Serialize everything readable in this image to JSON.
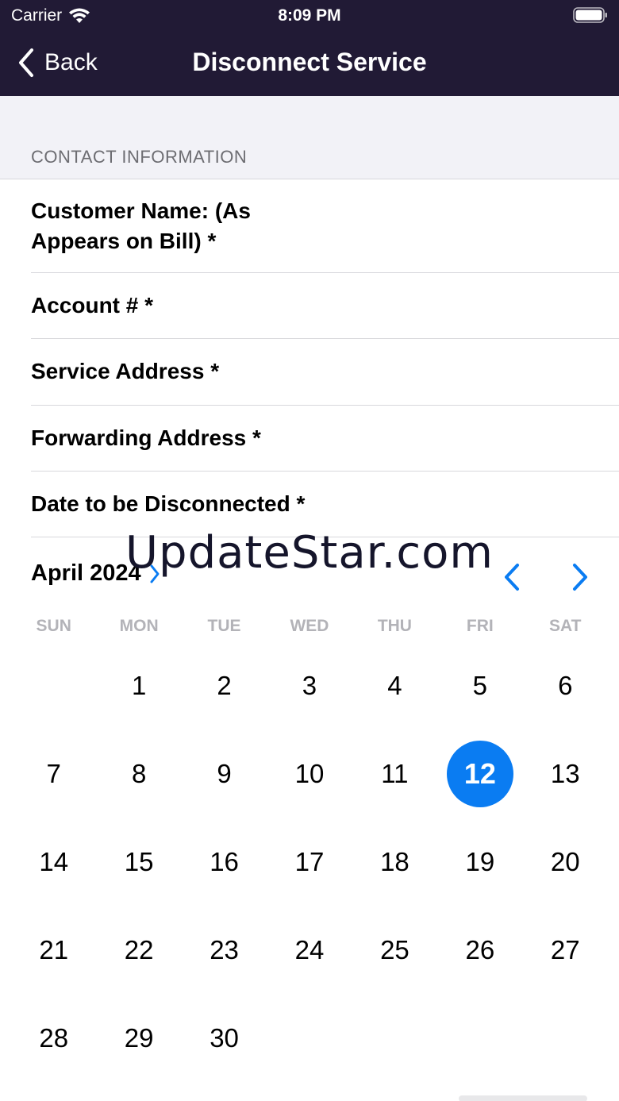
{
  "status_bar": {
    "carrier": "Carrier",
    "time": "8:09 PM"
  },
  "nav": {
    "back_label": "Back",
    "title": "Disconnect Service"
  },
  "section": {
    "label": "CONTACT INFORMATION"
  },
  "form": {
    "customer_name": "Customer Name: (As Appears on Bill) *",
    "account": "Account # *",
    "service_address": "Service Address *",
    "forwarding_address": "Forwarding Address *",
    "disconnect_date": "Date to be Disconnected *"
  },
  "watermark": "UpdateStar.com",
  "calendar": {
    "month_label": "April 2024",
    "weekdays": [
      "SUN",
      "MON",
      "TUE",
      "WED",
      "THU",
      "FRI",
      "SAT"
    ],
    "first_weekday_index": 1,
    "days_in_month": 30,
    "selected_day": 12
  },
  "colors": {
    "nav_bg": "#211a35",
    "accent": "#0a7cf2",
    "section_bg": "#f2f2f7"
  },
  "icons": {
    "wifi": "wifi-icon",
    "battery": "battery-icon",
    "back": "chevron-left-icon",
    "month_expand": "chevron-right-icon",
    "prev_month": "chevron-left-icon",
    "next_month": "chevron-right-icon"
  }
}
